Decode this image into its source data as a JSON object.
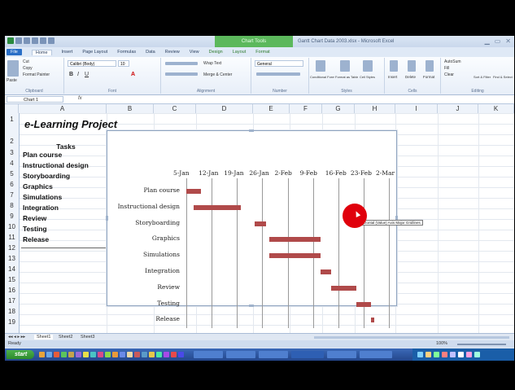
{
  "window": {
    "title": "Gantt Chart Data 2003.xlsx - Microsoft Excel",
    "context_tab": "Chart Tools"
  },
  "ribbon": {
    "tabs": [
      "File",
      "Home",
      "Insert",
      "Page Layout",
      "Formulas",
      "Data",
      "Review",
      "View",
      "Design",
      "Layout",
      "Format"
    ],
    "font_name": "Calibri (Body)",
    "font_size": "10",
    "groups": [
      "Clipboard",
      "Font",
      "Alignment",
      "Number",
      "Styles",
      "Cells",
      "Editing"
    ],
    "buttons": [
      "Paste",
      "Cut",
      "Copy",
      "Format Painter",
      "Wrap Text",
      "Merge & Center",
      "General",
      "Conditional Formatting",
      "Format as Table",
      "Cell Styles",
      "Insert",
      "Delete",
      "Format",
      "AutoSum",
      "Fill",
      "Clear",
      "Sort & Filter",
      "Find & Select"
    ]
  },
  "formula_bar": {
    "name_box": "Chart 1",
    "fx": "fx"
  },
  "columns": [
    "A",
    "B",
    "C",
    "D",
    "E",
    "F",
    "G",
    "H",
    "I",
    "J",
    "K"
  ],
  "rows": [
    "1",
    "2",
    "3",
    "4",
    "5",
    "6",
    "7",
    "8",
    "9",
    "10",
    "11",
    "12",
    "13",
    "14",
    "15",
    "16",
    "17",
    "18",
    "19"
  ],
  "sheet": {
    "title": "e-Learning Project",
    "tasks_header": "Tasks",
    "tasks": [
      "Plan course",
      "Instructional design",
      "Storyboarding",
      "Graphics",
      "Simulations",
      "Integration",
      "Review",
      "Testing",
      "Release"
    ]
  },
  "chart_data": {
    "type": "bar",
    "subtype": "gantt (stacked horizontal bar, start series hidden)",
    "categories": [
      "Plan course",
      "Instructional design",
      "Storyboarding",
      "Graphics",
      "Simulations",
      "Integration",
      "Review",
      "Testing",
      "Release"
    ],
    "x_tick_labels": [
      "5-Jan",
      "12-Jan",
      "19-Jan",
      "26-Jan",
      "2-Feb",
      "9-Feb",
      "16-Feb",
      "23-Feb",
      "2-Mar"
    ],
    "x_axis_position": "top",
    "series": [
      {
        "values": [
          {
            "start": "5-Jan",
            "end": "9-Jan"
          },
          {
            "start": "7-Jan",
            "end": "20-Jan"
          },
          {
            "start": "24-Jan",
            "end": "27-Jan"
          },
          {
            "start": "28-Jan",
            "end": "11-Feb"
          },
          {
            "start": "28-Jan",
            "end": "11-Feb"
          },
          {
            "start": "11-Feb",
            "end": "14-Feb"
          },
          {
            "start": "14-Feb",
            "end": "21-Feb"
          },
          {
            "start": "21-Feb",
            "end": "25-Feb"
          },
          {
            "start": "25-Feb",
            "end": "26-Feb"
          }
        ]
      }
    ],
    "bar_color": "#b04a4a",
    "grid": "vertical major gridlines"
  },
  "tooltip": "Horizontal (Value) Axis Major Gridlines",
  "sheet_tabs": [
    "Sheet1",
    "Sheet2",
    "Sheet3"
  ],
  "status": {
    "left": "Ready",
    "zoom": "100%"
  },
  "taskbar": {
    "start": "start"
  }
}
